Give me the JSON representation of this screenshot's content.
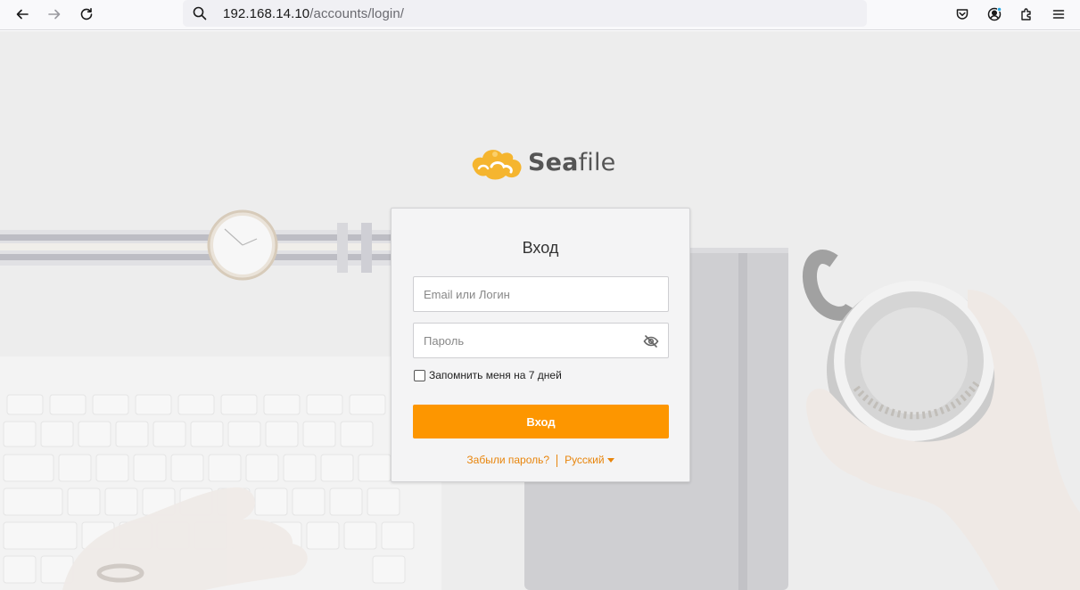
{
  "browser": {
    "url_host": "192.168.14.10",
    "url_path": "/accounts/login/",
    "icons": {
      "back": "back-arrow-icon",
      "forward": "forward-arrow-icon",
      "reload": "reload-icon",
      "search": "search-icon",
      "pocket": "pocket-icon",
      "account": "account-icon",
      "extensions": "extensions-icon",
      "menu": "hamburger-menu-icon"
    }
  },
  "logo": {
    "sea": "Sea",
    "file": "file"
  },
  "login": {
    "title": "Вход",
    "email_placeholder": "Email или Логин",
    "password_placeholder": "Пароль",
    "remember_label": "Запомнить меня на 7 дней",
    "submit_label": "Вход",
    "forgot_password": "Забыли пароль?",
    "language": "Русский"
  },
  "colors": {
    "accent": "#fd9600",
    "link": "#e8850c",
    "logo_cloud": "#f5b52f"
  }
}
